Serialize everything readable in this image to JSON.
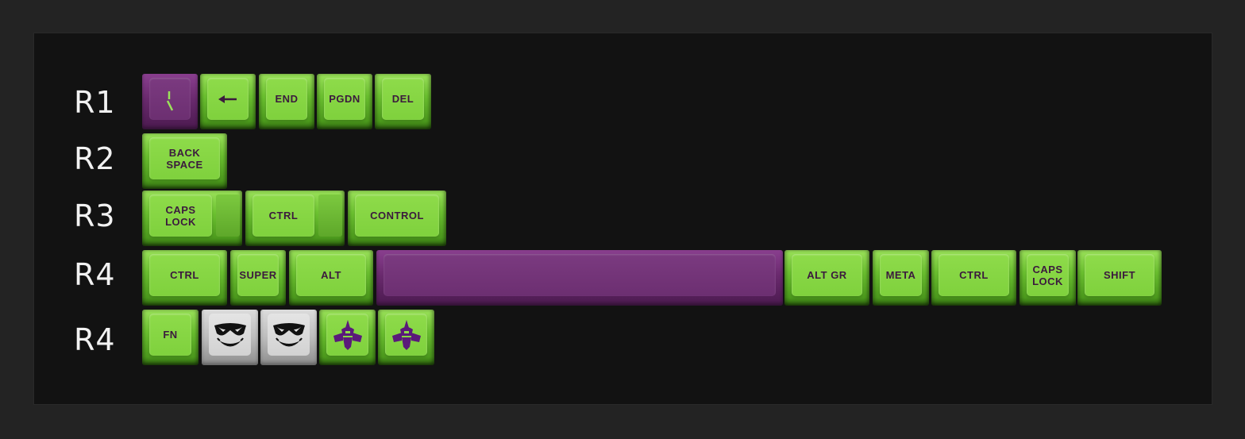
{
  "row_labels": [
    "R1",
    "R2",
    "R3",
    "R4",
    "R4"
  ],
  "rows": {
    "r1": [
      {
        "legend": "",
        "color": "purple",
        "icon": "tilde-slash-icon"
      },
      {
        "legend": "",
        "color": "green",
        "icon": "arrow-left-icon"
      },
      {
        "legend": "END",
        "color": "green"
      },
      {
        "legend": "PGDN",
        "color": "green"
      },
      {
        "legend": "DEL",
        "color": "green"
      }
    ],
    "r2": [
      {
        "legend": "BACK\nSPACE",
        "color": "green"
      }
    ],
    "r3": [
      {
        "legend": "CAPS\nLOCK",
        "color": "green",
        "stepped": true
      },
      {
        "legend": "CTRL",
        "color": "green",
        "stepped": true
      },
      {
        "legend": "CONTROL",
        "color": "green"
      }
    ],
    "r4": [
      {
        "legend": "CTRL",
        "color": "green"
      },
      {
        "legend": "SUPER",
        "color": "green"
      },
      {
        "legend": "ALT",
        "color": "green"
      },
      {
        "legend": "",
        "color": "purple"
      },
      {
        "legend": "ALT GR",
        "color": "green"
      },
      {
        "legend": "META",
        "color": "green"
      },
      {
        "legend": "CTRL",
        "color": "green"
      },
      {
        "legend": "CAPS\nLOCK",
        "color": "green"
      },
      {
        "legend": "SHIFT",
        "color": "green"
      }
    ],
    "r5": [
      {
        "legend": "FN",
        "color": "green"
      },
      {
        "legend": "",
        "color": "white",
        "icon": "joker-face-icon"
      },
      {
        "legend": "",
        "color": "white",
        "icon": "joker-face-icon"
      },
      {
        "legend": "",
        "color": "green",
        "icon": "eva-unit-icon"
      },
      {
        "legend": "",
        "color": "green",
        "icon": "eva-unit-icon"
      }
    ]
  },
  "colors": {
    "background": "#232323",
    "panel": "#121212",
    "key_green": "#7fd13d",
    "key_purple": "#6c2f71",
    "key_white": "#d2d2d2",
    "legend": "#3b1a3d",
    "label": "#f2f2f2"
  }
}
